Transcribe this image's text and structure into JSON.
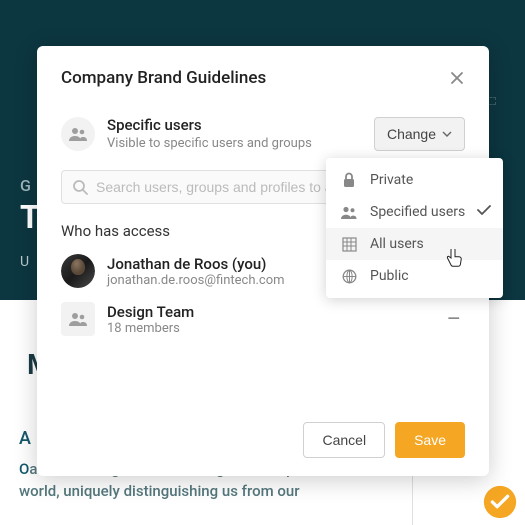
{
  "modal": {
    "title": "Company Brand Guidelines",
    "permission": {
      "title": "Specific users",
      "subtitle": "Visible to specific users and groups"
    },
    "change_label": "Change",
    "search_placeholder": "Search users, groups and profiles to add",
    "access_label": "Who has access",
    "users": [
      {
        "name": "Jonathan de Roos (you)",
        "sub": "jonathan.de.roos@fintech.com"
      },
      {
        "name": "Design Team",
        "sub": "18 members"
      }
    ],
    "cancel_label": "Cancel",
    "save_label": "Save"
  },
  "dropdown": {
    "items": [
      {
        "label": "Private",
        "icon": "lock",
        "selected": false
      },
      {
        "label": "Specified users",
        "icon": "users",
        "selected": true
      },
      {
        "label": "All users",
        "icon": "org",
        "selected": false
      },
      {
        "label": "Public",
        "icon": "globe",
        "selected": false
      }
    ]
  },
  "background": {
    "g": "G",
    "t": "T",
    "u": "U",
    "m": "M",
    "a": "A",
    "o": "O",
    "body": "and is among the most recognized corporate identities in the world, uniquely distinguishing us from our"
  }
}
